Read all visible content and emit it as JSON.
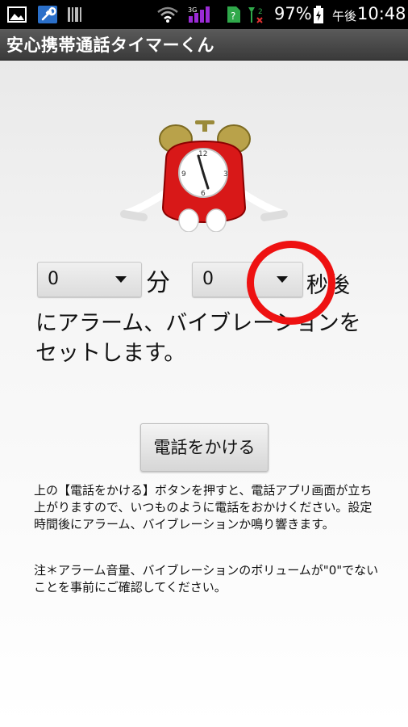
{
  "status_bar": {
    "battery_percent": "97%",
    "ampm": "午後",
    "time": "10:48",
    "icons": [
      "image-icon",
      "wrench-icon",
      "barcode-icon",
      "wifi-icon",
      "signal-icon",
      "sim-question-icon",
      "no-signal-icon",
      "battery-icon"
    ]
  },
  "app": {
    "title": "安心携帯通話タイマーくん"
  },
  "timer": {
    "minutes_value": "0",
    "minutes_unit": "分",
    "seconds_value": "0",
    "seconds_unit": "秒後"
  },
  "message": "にアラーム、バイブレーションをセットします。",
  "call_button_label": "電話をかける",
  "info": {
    "paragraph1": "上の【電話をかける】ボタンを押すと、電話アプリ画面が立ち上がりますので、いつものように電話をおかけください。設定時間後にアラーム、バイブレーションか鳴り響きます。",
    "paragraph2": "注＊アラーム音量、バイブレーションのボリュームが\"0\"でないことを事前にご確認してください。"
  },
  "colors": {
    "annotation_ring": "#ee1111",
    "status_bar": "#000000",
    "title_bar": "#4a4a4a"
  }
}
